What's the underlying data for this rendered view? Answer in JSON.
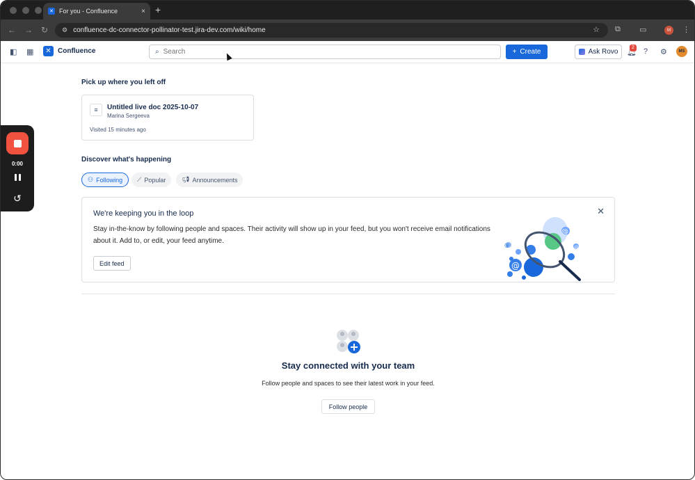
{
  "browser": {
    "tab_title": "For you - Confluence",
    "tab_close": "×",
    "new_tab": "+",
    "url": "confluence-dc-connector-pollinator-test.jira-dev.com/wiki/home",
    "profile_initial": "M"
  },
  "header": {
    "app_name": "Confluence",
    "search_placeholder": "Search",
    "create_label": "Create",
    "ask_rovo_label": "Ask Rovo",
    "notifications_count": "2",
    "avatar_initials": "MS"
  },
  "recorder": {
    "time": "0:00"
  },
  "recent": {
    "heading": "Pick up where you left off",
    "doc_title": "Untitled live doc 2025-10-07",
    "doc_author": "Marina Sergeeva",
    "visited": "Visited 15 minutes ago"
  },
  "discover": {
    "heading": "Discover what's happening",
    "tabs": [
      {
        "label": "Following",
        "icon": "people-icon"
      },
      {
        "label": "Popular",
        "icon": "trend-icon"
      },
      {
        "label": "Announcements",
        "icon": "megaphone-icon"
      }
    ]
  },
  "loop_card": {
    "title": "We're keeping you in the loop",
    "body": "Stay in-the-know by following people and spaces. Their activity will show up in your feed, but you won't receive email notifications about it. Add to, or edit, your feed anytime.",
    "edit_label": "Edit feed"
  },
  "empty_state": {
    "title": "Stay connected with your team",
    "body": "Follow people and spaces to see their latest work in your feed.",
    "button": "Follow people"
  },
  "colors": {
    "brand": "#1868db",
    "record": "#f0523f",
    "avatar": "#e38b2d"
  }
}
